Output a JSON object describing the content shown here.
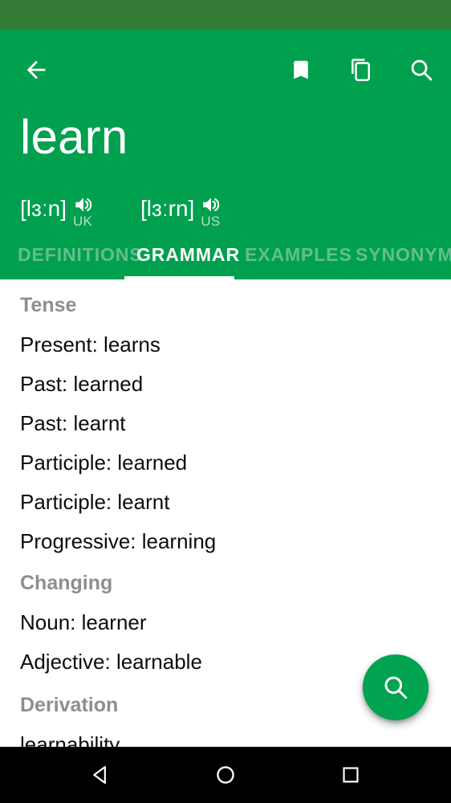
{
  "status_bar": {
    "background": "#337a35"
  },
  "app_bar": {
    "background": "#00a04f",
    "back_label": "Back",
    "bookmark_label": "Bookmark",
    "copy_label": "Copy",
    "search_label": "Search"
  },
  "headword": {
    "word": "learn"
  },
  "phonetics": [
    {
      "transcription": "[lɜːn]",
      "region": "UK"
    },
    {
      "transcription": "[lɜːrn]",
      "region": "US"
    }
  ],
  "tabs": {
    "active": "GRAMMAR",
    "items": [
      {
        "label": "DEFINITIONS",
        "active": false
      },
      {
        "label": "GRAMMAR",
        "active": true
      },
      {
        "label": "EXAMPLES",
        "active": false
      },
      {
        "label": "SYNONYM",
        "active": false
      }
    ]
  },
  "content": {
    "sections": [
      {
        "header": "Tense",
        "entries": [
          "Present: learns",
          "Past: learned",
          "Past: learnt",
          "Participle: learned",
          "Participle: learnt",
          "Progressive: learning"
        ]
      },
      {
        "header": "Changing",
        "entries": [
          "Noun: learner",
          "Adjective: learnable"
        ]
      },
      {
        "header": "Derivation",
        "entries": [
          "learnability"
        ]
      }
    ]
  },
  "fab": {
    "label": "Search",
    "color": "#00a34f"
  },
  "nav_bar": {
    "background": "#000000",
    "back_label": "Back",
    "home_label": "Home",
    "recents_label": "Recents"
  }
}
